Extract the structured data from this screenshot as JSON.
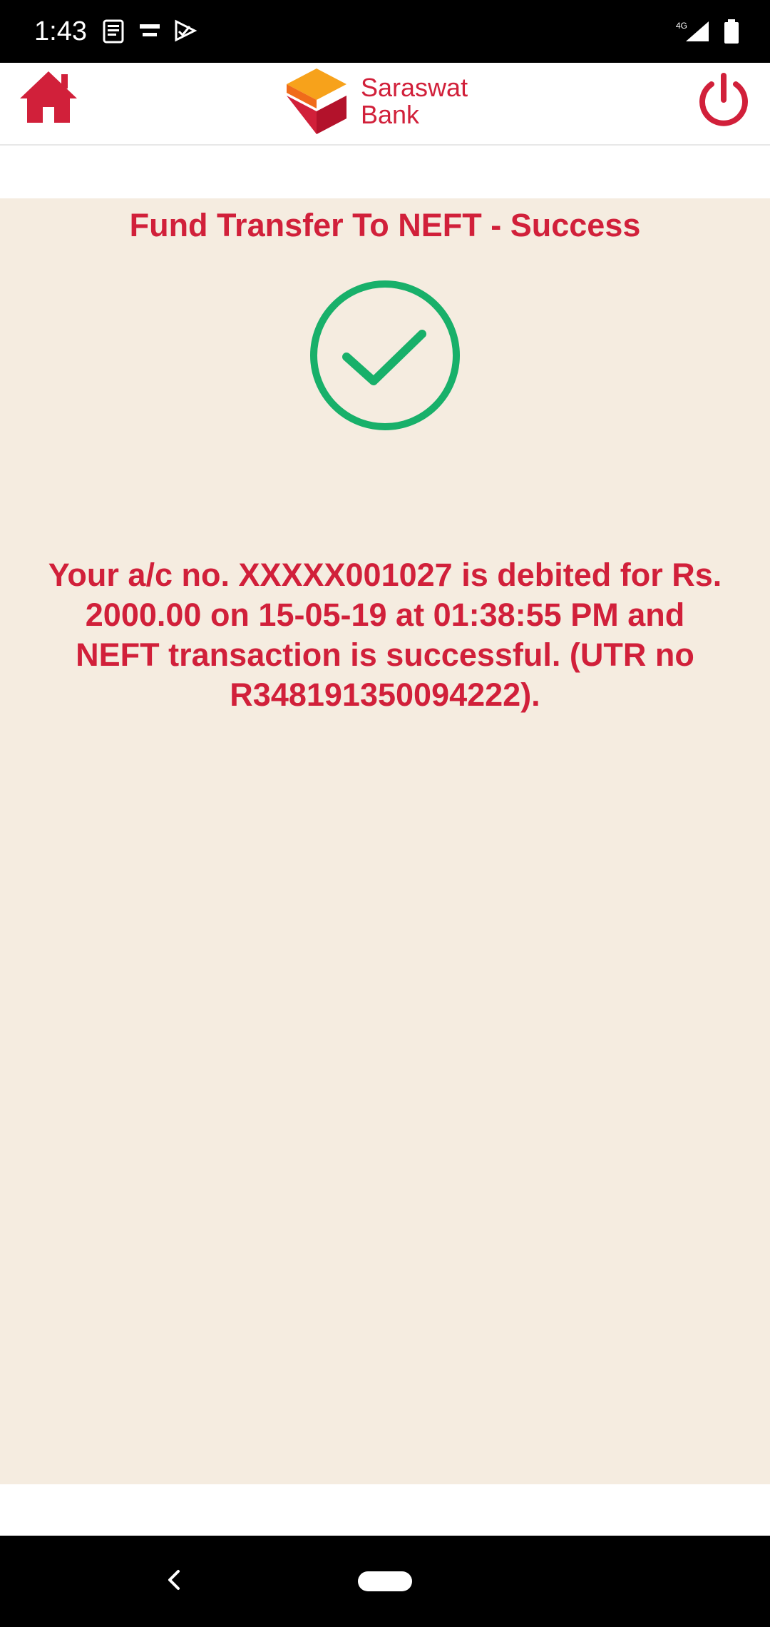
{
  "status_bar": {
    "time": "1:43",
    "left_icons": [
      "news-icon",
      "tata-sky-icon",
      "check-flag-icon"
    ],
    "right_icons": [
      "signal-4g-icon",
      "battery-icon"
    ],
    "network_label": "4G"
  },
  "header": {
    "home_icon": "home-icon",
    "logo_line1": "Saraswat",
    "logo_line2": "Bank",
    "power_icon": "power-icon"
  },
  "result": {
    "title": "Fund Transfer To NEFT - Success",
    "status_icon": "check-circle-icon",
    "message": "Your a/c no. XXXXX001027 is debited for Rs. 2000.00 on 15-05-19 at 01:38:55 PM and NEFT transaction is successful. (UTR no R348191350094222)."
  },
  "nav_bar": {
    "back_icon": "back-chevron-icon",
    "home_pill": "home-pill"
  },
  "colors": {
    "brand_red": "#d1203a",
    "success_green": "#18b06a",
    "content_bg": "#f5ece0"
  }
}
